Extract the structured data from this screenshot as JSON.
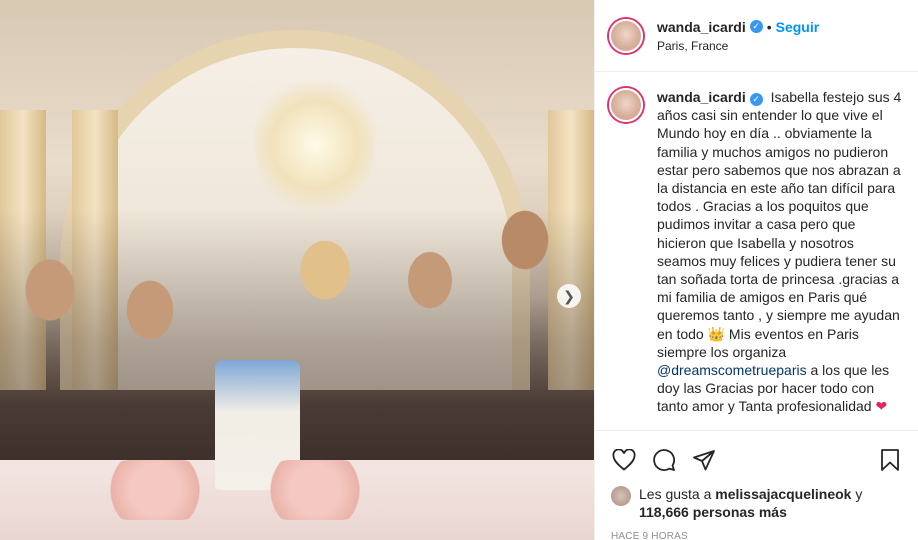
{
  "post": {
    "username": "wanda_icardi",
    "follow_label": "Seguir",
    "location": "Paris, France",
    "caption_part1": "Isabella festejo sus 4 años casi sin entender lo que vive el Mundo hoy en día .. obviamente la familia y muchos amigos no pudieron estar pero sabemos que nos abrazan a la distancia en este año tan difícil para todos . Gracias a los poquitos que pudimos invitar a casa pero que hicieron que Isabella y nosotros seamos muy felices y pudiera tener su tan soñada torta de princesa .gracias a mi familia de amigos en Paris qué queremos tanto , y siempre me ayudan en todo",
    "crown_emoji": "👑",
    "caption_part2": " Mis eventos en Paris siempre los organiza ",
    "mention": "@dreamscometrueparis",
    "caption_part3": " a los que les doy las Gracias por hacer todo con tanto amor y Tanta profesionalidad ",
    "heart_emoji": "❤",
    "likes_prefix": "Les gusta a ",
    "likes_user": "melissajacquelineok",
    "likes_suffix": " y",
    "likes_count": "118,666 personas más",
    "timestamp": "HACE 9 HORAS"
  },
  "icons": {
    "verified": "verified-badge-icon",
    "like": "heart-outline-icon",
    "comment": "comment-bubble-icon",
    "share": "paper-plane-icon",
    "save": "bookmark-icon",
    "next": "chevron-right-icon"
  },
  "colors": {
    "link_blue": "#0095f6",
    "verified_blue": "#3897f0",
    "mention_blue": "#00376b",
    "muted_gray": "#8e8e8e"
  }
}
